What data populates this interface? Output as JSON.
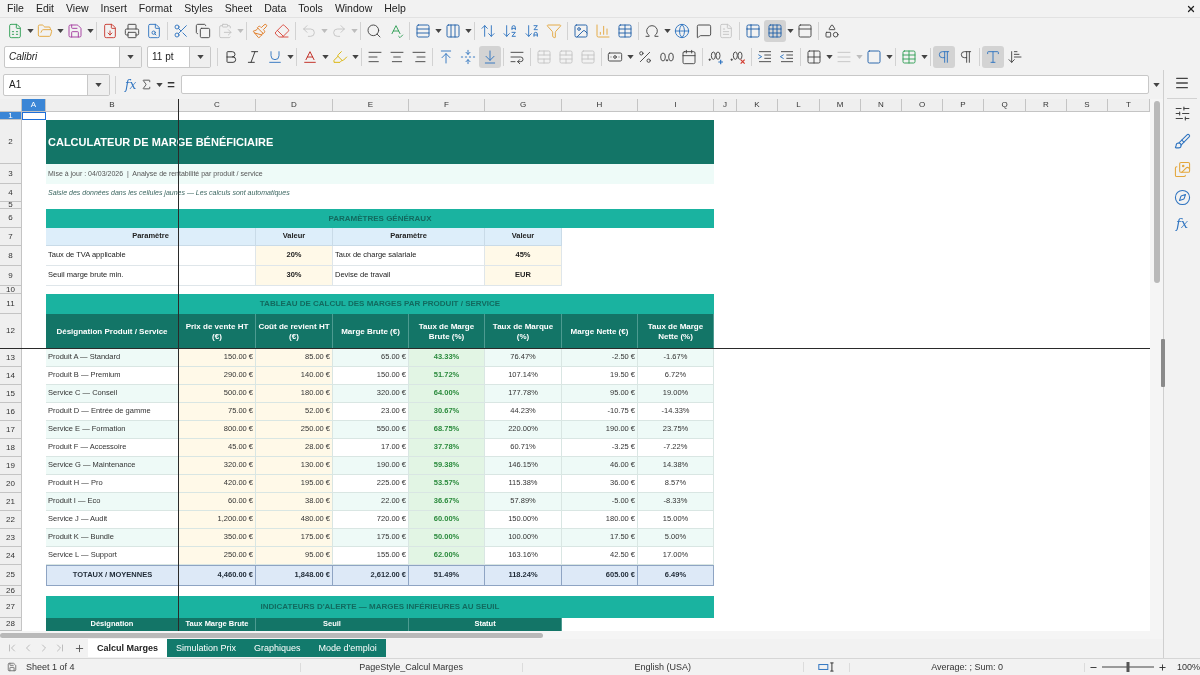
{
  "menu": [
    "File",
    "Edit",
    "View",
    "Insert",
    "Format",
    "Styles",
    "Sheet",
    "Data",
    "Tools",
    "Window",
    "Help"
  ],
  "standard_toolbar": [
    [
      {
        "kind": "new",
        "dropdown": true,
        "pressed": false,
        "disabled": false
      },
      {
        "kind": "open",
        "dropdown": true,
        "pressed": false,
        "disabled": false
      },
      {
        "kind": "save",
        "dropdown": true,
        "pressed": false,
        "disabled": false
      }
    ],
    [
      {
        "kind": "pdf",
        "dropdown": false,
        "pressed": false,
        "disabled": false
      },
      {
        "kind": "print",
        "dropdown": false,
        "pressed": false,
        "disabled": false
      },
      {
        "kind": "preview",
        "dropdown": false,
        "pressed": false,
        "disabled": false
      }
    ],
    [
      {
        "kind": "cut",
        "dropdown": false,
        "pressed": false,
        "disabled": false
      },
      {
        "kind": "copy",
        "dropdown": false,
        "pressed": false,
        "disabled": false
      },
      {
        "kind": "paste",
        "dropdown": true,
        "pressed": false,
        "disabled": true
      }
    ],
    [
      {
        "kind": "clone",
        "dropdown": false,
        "pressed": false,
        "disabled": false
      },
      {
        "kind": "clear",
        "dropdown": false,
        "pressed": false,
        "disabled": false
      }
    ],
    [
      {
        "kind": "undo",
        "dropdown": true,
        "pressed": false,
        "disabled": true
      },
      {
        "kind": "redo",
        "dropdown": true,
        "pressed": false,
        "disabled": true
      }
    ],
    [
      {
        "kind": "find",
        "dropdown": false,
        "pressed": false,
        "disabled": false
      },
      {
        "kind": "spelling",
        "dropdown": false,
        "pressed": false,
        "disabled": false
      }
    ],
    [
      {
        "kind": "rows",
        "dropdown": true,
        "pressed": false,
        "disabled": false
      },
      {
        "kind": "columns",
        "dropdown": true,
        "pressed": false,
        "disabled": false
      }
    ],
    [
      {
        "kind": "sort",
        "dropdown": false,
        "pressed": false,
        "disabled": false
      },
      {
        "kind": "ascending",
        "dropdown": false,
        "pressed": false,
        "disabled": false
      },
      {
        "kind": "descending",
        "dropdown": false,
        "pressed": false,
        "disabled": false
      },
      {
        "kind": "autofilter",
        "dropdown": false,
        "pressed": false,
        "disabled": false
      }
    ],
    [
      {
        "kind": "image",
        "dropdown": false,
        "pressed": false,
        "disabled": false
      },
      {
        "kind": "chart",
        "dropdown": false,
        "pressed": false,
        "disabled": false
      },
      {
        "kind": "pivot",
        "dropdown": false,
        "pressed": false,
        "disabled": false
      }
    ],
    [
      {
        "kind": "special",
        "dropdown": true,
        "pressed": false,
        "disabled": false
      },
      {
        "kind": "hyperlink",
        "dropdown": false,
        "pressed": false,
        "disabled": false
      },
      {
        "kind": "comment",
        "dropdown": false,
        "pressed": false,
        "disabled": false
      },
      {
        "kind": "headers",
        "dropdown": false,
        "pressed": false,
        "disabled": true
      }
    ],
    [
      {
        "kind": "printarea",
        "dropdown": false,
        "pressed": false,
        "disabled": false
      },
      {
        "kind": "freeze",
        "dropdown": true,
        "pressed": true,
        "disabled": false
      },
      {
        "kind": "split",
        "dropdown": false,
        "pressed": false,
        "disabled": false
      }
    ],
    [
      {
        "kind": "draw",
        "dropdown": false,
        "pressed": false,
        "disabled": false
      }
    ]
  ],
  "formatting_toolbar": {
    "font_name": "Calibri",
    "font_size": "11 pt",
    "groups": [
      [
        {
          "kind": "bold",
          "dropdown": false,
          "pressed": false,
          "disabled": false
        },
        {
          "kind": "italic",
          "dropdown": false,
          "pressed": false,
          "disabled": false
        },
        {
          "kind": "underline",
          "dropdown": true,
          "pressed": false,
          "disabled": false
        }
      ],
      [
        {
          "kind": "fontcolor",
          "dropdown": true,
          "pressed": false,
          "disabled": false
        },
        {
          "kind": "highlight",
          "dropdown": true,
          "pressed": false,
          "disabled": false
        }
      ],
      [
        {
          "kind": "left",
          "dropdown": false,
          "pressed": false,
          "disabled": false
        },
        {
          "kind": "center",
          "dropdown": false,
          "pressed": false,
          "disabled": false
        },
        {
          "kind": "right",
          "dropdown": false,
          "pressed": false,
          "disabled": false
        }
      ],
      [
        {
          "kind": "top",
          "dropdown": false,
          "pressed": false,
          "disabled": false
        },
        {
          "kind": "middle",
          "dropdown": false,
          "pressed": false,
          "disabled": false
        },
        {
          "kind": "bottom",
          "dropdown": false,
          "pressed": true,
          "disabled": false
        }
      ],
      [
        {
          "kind": "wrap",
          "dropdown": false,
          "pressed": false,
          "disabled": false
        }
      ],
      [
        {
          "kind": "merge",
          "dropdown": false,
          "pressed": false,
          "disabled": true
        },
        {
          "kind": "mergecells",
          "dropdown": false,
          "pressed": false,
          "disabled": true
        },
        {
          "kind": "unmerge",
          "dropdown": false,
          "pressed": false,
          "disabled": true
        }
      ],
      [
        {
          "kind": "currency",
          "dropdown": true,
          "pressed": false,
          "disabled": false
        },
        {
          "kind": "percent",
          "dropdown": false,
          "pressed": false,
          "disabled": false
        },
        {
          "kind": "number",
          "dropdown": false,
          "pressed": false,
          "disabled": false
        },
        {
          "kind": "date",
          "dropdown": false,
          "pressed": false,
          "disabled": false
        }
      ],
      [
        {
          "kind": "adddecimal",
          "dropdown": false,
          "pressed": false,
          "disabled": false
        },
        {
          "kind": "deletedecimal",
          "dropdown": false,
          "pressed": false,
          "disabled": false
        }
      ],
      [
        {
          "kind": "indent",
          "dropdown": false,
          "pressed": false,
          "disabled": false
        },
        {
          "kind": "outdent",
          "dropdown": false,
          "pressed": false,
          "disabled": false
        }
      ],
      [
        {
          "kind": "borders",
          "dropdown": true,
          "pressed": false,
          "disabled": false
        },
        {
          "kind": "borderstyle",
          "dropdown": true,
          "pressed": false,
          "disabled": true
        },
        {
          "kind": "bordercolor",
          "dropdown": true,
          "pressed": false,
          "disabled": false
        }
      ],
      [
        {
          "kind": "conditional",
          "dropdown": true,
          "pressed": false,
          "disabled": false
        }
      ],
      [
        {
          "kind": "ltr",
          "dropdown": false,
          "pressed": true,
          "disabled": false
        },
        {
          "kind": "rtl",
          "dropdown": false,
          "pressed": false,
          "disabled": false
        }
      ],
      [
        {
          "kind": "horizontal",
          "dropdown": false,
          "pressed": true,
          "disabled": false
        },
        {
          "kind": "vertical",
          "dropdown": false,
          "pressed": false,
          "disabled": false
        }
      ]
    ]
  },
  "formula_bar": {
    "name_box": "A1",
    "function_label": "fx",
    "equals_label": "="
  },
  "sheet": {
    "column_headers": [
      {
        "label": "A",
        "selected": true
      },
      {
        "label": "B",
        "selected": false
      },
      {
        "label": "C",
        "selected": false
      },
      {
        "label": "D",
        "selected": false
      },
      {
        "label": "E",
        "selected": false
      },
      {
        "label": "F",
        "selected": false
      },
      {
        "label": "G",
        "selected": false
      },
      {
        "label": "H",
        "selected": false
      },
      {
        "label": "I",
        "selected": false
      },
      {
        "label": "J",
        "selected": false
      },
      {
        "label": "K",
        "selected": false
      },
      {
        "label": "L",
        "selected": false
      },
      {
        "label": "M",
        "selected": false
      },
      {
        "label": "N",
        "selected": false
      },
      {
        "label": "O",
        "selected": false
      },
      {
        "label": "P",
        "selected": false
      },
      {
        "label": "Q",
        "selected": false
      },
      {
        "label": "R",
        "selected": false
      },
      {
        "label": "S",
        "selected": false
      },
      {
        "label": "T",
        "selected": false
      }
    ],
    "row_headers": [
      {
        "label": "1",
        "selected": true
      },
      {
        "label": "2",
        "selected": false
      },
      {
        "label": "3",
        "selected": false
      },
      {
        "label": "4",
        "selected": false
      },
      {
        "label": "5",
        "selected": false
      },
      {
        "label": "6",
        "selected": false
      },
      {
        "label": "7",
        "selected": false
      },
      {
        "label": "8",
        "selected": false
      },
      {
        "label": "9",
        "selected": false
      },
      {
        "label": "10",
        "selected": false
      },
      {
        "label": "11",
        "selected": false
      },
      {
        "label": "12",
        "selected": false
      },
      {
        "label": "13",
        "selected": false
      },
      {
        "label": "14",
        "selected": false
      },
      {
        "label": "15",
        "selected": false
      },
      {
        "label": "16",
        "selected": false
      },
      {
        "label": "17",
        "selected": false
      },
      {
        "label": "18",
        "selected": false
      },
      {
        "label": "19",
        "selected": false
      },
      {
        "label": "20",
        "selected": false
      },
      {
        "label": "21",
        "selected": false
      },
      {
        "label": "22",
        "selected": false
      },
      {
        "label": "23",
        "selected": false
      },
      {
        "label": "24",
        "selected": false
      },
      {
        "label": "25",
        "selected": false
      },
      {
        "label": "26",
        "selected": false
      },
      {
        "label": "27",
        "selected": false
      },
      {
        "label": "28",
        "selected": false
      }
    ],
    "title": "CALCULATEUR DE MARGE BÉNÉFICIAIRE",
    "subtitle": "Mise à jour : 04/03/2026  |  Analyse de rentabilité par produit / service",
    "note": "Saisie des données dans les cellules jaunes — Les calculs sont automatiques",
    "parameters": {
      "title": "PARAMÈTRES GÉNÉRAUX",
      "headers": [
        "Paramètre",
        "Valeur",
        "Paramètre",
        "Valeur"
      ],
      "rows": [
        [
          "Taux de TVA applicable",
          "20%",
          "Taux de charge salariale",
          "45%"
        ],
        [
          "Seuil marge brute min.",
          "30%",
          "Devise de travail",
          "EUR"
        ]
      ]
    },
    "margins": {
      "title": "TABLEAU DE CALCUL DES MARGES PAR PRODUIT / SERVICE",
      "headers": [
        {
          "label": "Désignation Produit / Service",
          "kind": "label"
        },
        {
          "label": "Prix de vente HT (€)",
          "kind": "input"
        },
        {
          "label": "Coût de revient HT (€)",
          "kind": "input"
        },
        {
          "label": "Marge Brute (€)",
          "kind": "amount"
        },
        {
          "label": "Taux de Marge Brute (%)",
          "kind": "highlight"
        },
        {
          "label": "Taux de Marque (%)",
          "kind": "percent"
        },
        {
          "label": "Marge Nette (€)",
          "kind": "amount"
        },
        {
          "label": "Taux de Marge Nette (%)",
          "kind": "percent"
        }
      ],
      "rows": [
        [
          "Produit A — Standard",
          "150.00 €",
          "85.00 €",
          "65.00 €",
          "43.33%",
          "76.47%",
          "-2.50 €",
          "-1.67%"
        ],
        [
          "Produit B — Premium",
          "290.00 €",
          "140.00 €",
          "150.00 €",
          "51.72%",
          "107.14%",
          "19.50 €",
          "6.72%"
        ],
        [
          "Service C — Conseil",
          "500.00 €",
          "180.00 €",
          "320.00 €",
          "64.00%",
          "177.78%",
          "95.00 €",
          "19.00%"
        ],
        [
          "Produit D — Entrée de gamme",
          "75.00 €",
          "52.00 €",
          "23.00 €",
          "30.67%",
          "44.23%",
          "-10.75 €",
          "-14.33%"
        ],
        [
          "Service E — Formation",
          "800.00 €",
          "250.00 €",
          "550.00 €",
          "68.75%",
          "220.00%",
          "190.00 €",
          "23.75%"
        ],
        [
          "Produit F — Accessoire",
          "45.00 €",
          "28.00 €",
          "17.00 €",
          "37.78%",
          "60.71%",
          "-3.25 €",
          "-7.22%"
        ],
        [
          "Service G — Maintenance",
          "320.00 €",
          "130.00 €",
          "190.00 €",
          "59.38%",
          "146.15%",
          "46.00 €",
          "14.38%"
        ],
        [
          "Produit H — Pro",
          "420.00 €",
          "195.00 €",
          "225.00 €",
          "53.57%",
          "115.38%",
          "36.00 €",
          "8.57%"
        ],
        [
          "Produit I — Eco",
          "60.00 €",
          "38.00 €",
          "22.00 €",
          "36.67%",
          "57.89%",
          "-5.00 €",
          "-8.33%"
        ],
        [
          "Service J — Audit",
          "1,200.00 €",
          "480.00 €",
          "720.00 €",
          "60.00%",
          "150.00%",
          "180.00 €",
          "15.00%"
        ],
        [
          "Produit K — Bundle",
          "350.00 €",
          "175.00 €",
          "175.00 €",
          "50.00%",
          "100.00%",
          "17.50 €",
          "5.00%"
        ],
        [
          "Service L — Support",
          "250.00 €",
          "95.00 €",
          "155.00 €",
          "62.00%",
          "163.16%",
          "42.50 €",
          "17.00%"
        ]
      ],
      "totals": [
        "TOTAUX / MOYENNES",
        "4,460.00 €",
        "1,848.00 €",
        "2,612.00 €",
        "51.49%",
        "118.24%",
        "605.00 €",
        "6.49%"
      ]
    },
    "alerts": {
      "title": "INDICATEURS D'ALERTE — MARGES INFÉRIEURES AU SEUIL",
      "headers": [
        "Désignation",
        "Taux Marge Brute",
        "Seuil",
        "Statut"
      ]
    }
  },
  "sheet_tabs": [
    {
      "label": "Calcul Marges",
      "selected": true
    },
    {
      "label": "Simulation Prix",
      "selected": false
    },
    {
      "label": "Graphiques",
      "selected": false
    },
    {
      "label": "Mode d'emploi",
      "selected": false
    }
  ],
  "sidebar": {
    "functions_label": "fx"
  },
  "status_bar": {
    "sheet": "Sheet 1 of 4",
    "page_style": "PageStyle_Calcul Marges",
    "language": "English (USA)",
    "summary": "Average: ; Sum: 0",
    "zoom": {
      "level": 0.5,
      "label": "100%"
    }
  }
}
